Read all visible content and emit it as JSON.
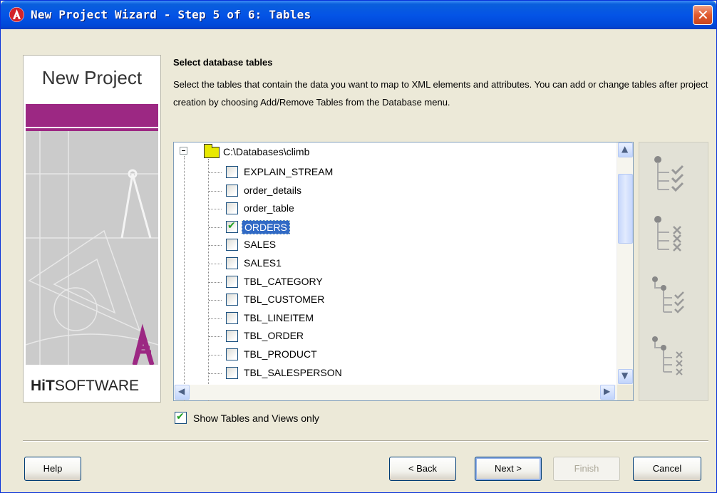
{
  "window": {
    "title": "New Project Wizard - Step 5 of 6: Tables",
    "close_glyph": "✕"
  },
  "brand": {
    "title": "New Project",
    "vendor_bold": "HiT",
    "vendor_rest": "SOFTWARE",
    "accent_color": "#9c2883"
  },
  "content": {
    "heading": "Select database tables",
    "description": "Select the tables that contain the data you want to map to XML elements and attributes. You can add or change tables after project creation by choosing Add/Remove Tables from the Database menu."
  },
  "tree": {
    "root": "C:\\Databases\\climb",
    "items": [
      {
        "label": "EXPLAIN_STREAM",
        "checked": false
      },
      {
        "label": "order_details",
        "checked": false
      },
      {
        "label": "order_table",
        "checked": false
      },
      {
        "label": "ORDERS",
        "checked": true,
        "selected": true
      },
      {
        "label": "SALES",
        "checked": false
      },
      {
        "label": "SALES1",
        "checked": false
      },
      {
        "label": "TBL_CATEGORY",
        "checked": false
      },
      {
        "label": "TBL_CUSTOMER",
        "checked": false
      },
      {
        "label": "TBL_LINEITEM",
        "checked": false
      },
      {
        "label": "TBL_ORDER",
        "checked": false
      },
      {
        "label": "TBL_PRODUCT",
        "checked": false
      },
      {
        "label": "TBL_SALESPERSON",
        "checked": false
      }
    ]
  },
  "actions": [
    {
      "name": "select-all-tables",
      "icon": "check-all-icon"
    },
    {
      "name": "deselect-all-tables",
      "icon": "uncheck-all-icon"
    },
    {
      "name": "select-child-tables",
      "icon": "check-children-icon"
    },
    {
      "name": "deselect-child-tables",
      "icon": "uncheck-children-icon"
    }
  ],
  "options": {
    "show_tables_label": "Show Tables and Views only",
    "show_tables_checked": true
  },
  "buttons": {
    "help": "Help",
    "back": "< Back",
    "next": "Next >",
    "finish": "Finish",
    "cancel": "Cancel"
  }
}
